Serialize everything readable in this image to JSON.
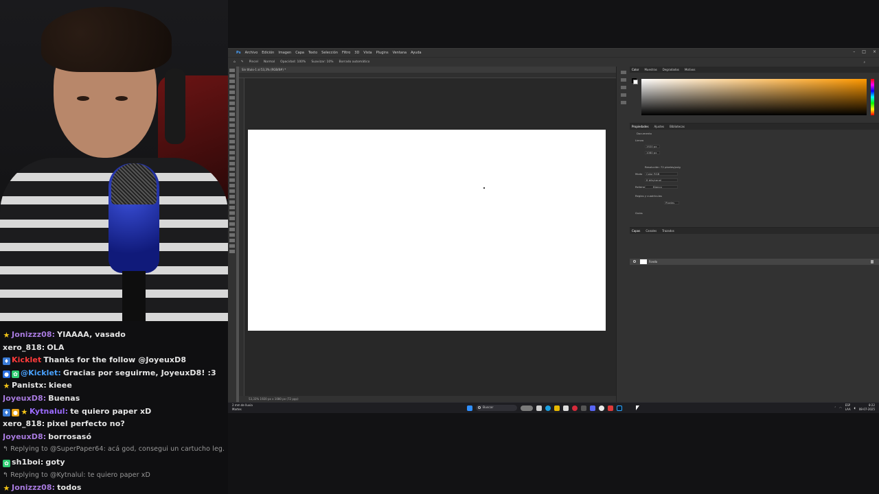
{
  "chat": {
    "messages": [
      {
        "badges": [
          "star"
        ],
        "user": "Jonizzz08:",
        "user_color": "#a97be0",
        "text": "YIAAAA, vasado",
        "reply": false
      },
      {
        "badges": [],
        "user": "xero_818:",
        "user_color": "#e6e6e6",
        "text": "OLA",
        "reply": false
      },
      {
        "badges": [
          "prime"
        ],
        "user": "Kicklet",
        "user_color": "#ff3b3b",
        "text": "Thanks for the follow @JoyeuxD8",
        "reply": false
      },
      {
        "badges": [
          "bot",
          "clover"
        ],
        "user": "@Kicklet:",
        "user_color": "#49a2ff",
        "text": "Gracias por seguirme, JoyeuxD8! :3",
        "reply": false
      },
      {
        "badges": [
          "star"
        ],
        "user": "Panistx:",
        "user_color": "#e6e6e6",
        "text": "kieee",
        "reply": false
      },
      {
        "badges": [],
        "user": "JoyeuxD8:",
        "user_color": "#a97be0",
        "text": "Buenas",
        "reply": false
      },
      {
        "badges": [
          "prime",
          "gold",
          "star"
        ],
        "user": "Kytnalul:",
        "user_color": "#9b6bff",
        "text": "te quiero paper xD",
        "reply": false
      },
      {
        "badges": [],
        "user": "xero_818:",
        "user_color": "#e6e6e6",
        "text": "pixel perfecto no?",
        "reply": false
      },
      {
        "badges": [],
        "user": "JoyeuxD8:",
        "user_color": "#a97be0",
        "text": "borrosasó",
        "reply": false
      },
      {
        "badges": [],
        "user": "",
        "user_color": "#9a9a9a",
        "text": "Replying to @SuperPaper64: acá god, consegui un cartucho leg...",
        "reply": true
      },
      {
        "badges": [
          "clover"
        ],
        "user": "sh1boi:",
        "user_color": "#e6e6e6",
        "text": "goty",
        "reply": false
      },
      {
        "badges": [],
        "user": "",
        "user_color": "#9a9a9a",
        "text": "Replying to @Kytnalul: te quiero paper xD",
        "reply": true
      },
      {
        "badges": [
          "star"
        ],
        "user": "Jonizzz08:",
        "user_color": "#a97be0",
        "text": "todos",
        "reply": false
      }
    ]
  },
  "photoshop": {
    "menu": [
      "Archivo",
      "Edición",
      "Imagen",
      "Capa",
      "Texto",
      "Selección",
      "Filtro",
      "3D",
      "Vista",
      "Plugins",
      "Ventana",
      "Ayuda"
    ],
    "window_controls": [
      "–",
      "□",
      "×"
    ],
    "options": [
      "Pincel",
      "Normal",
      "Opacidad: 100%",
      "Suavizar: 10%",
      "Borrado automático"
    ],
    "doc_tab": "Sin título-1 al 53,3% (RGB/8#) *",
    "status": "53,33%   1920 px x 1080 px (72 ppp)",
    "color_tabs": [
      "Color",
      "Muestras",
      "Degradados",
      "Motivos"
    ],
    "props_tabs": [
      "Propiedades",
      "Ajustes",
      "Bibliotecas"
    ],
    "props": {
      "section_document": "Documento",
      "section_canvas": "Lienzo",
      "width": "1920 px",
      "height": "1080 px",
      "resolution": "Resolución: 72 píxeles/pulg",
      "mode_label": "Modo",
      "mode": "Color RGB",
      "bits": "8 bits/canal",
      "fill_label": "Relleno",
      "fill": "Blanco",
      "section_rulers": "Reglas y cuadrículas",
      "pixels": "Píxeles",
      "section_guides": "Guías"
    },
    "layers_tabs": [
      "Capas",
      "Canales",
      "Trazados"
    ],
    "layer_name": "Fondo"
  },
  "taskbar": {
    "weather_line1": "2 mm de lluvia",
    "weather_line2": "Martes",
    "search_placeholder": "Buscar",
    "lang1": "ESP",
    "lang2": "LAA",
    "time": "8:22",
    "date": "08-07-2025"
  }
}
